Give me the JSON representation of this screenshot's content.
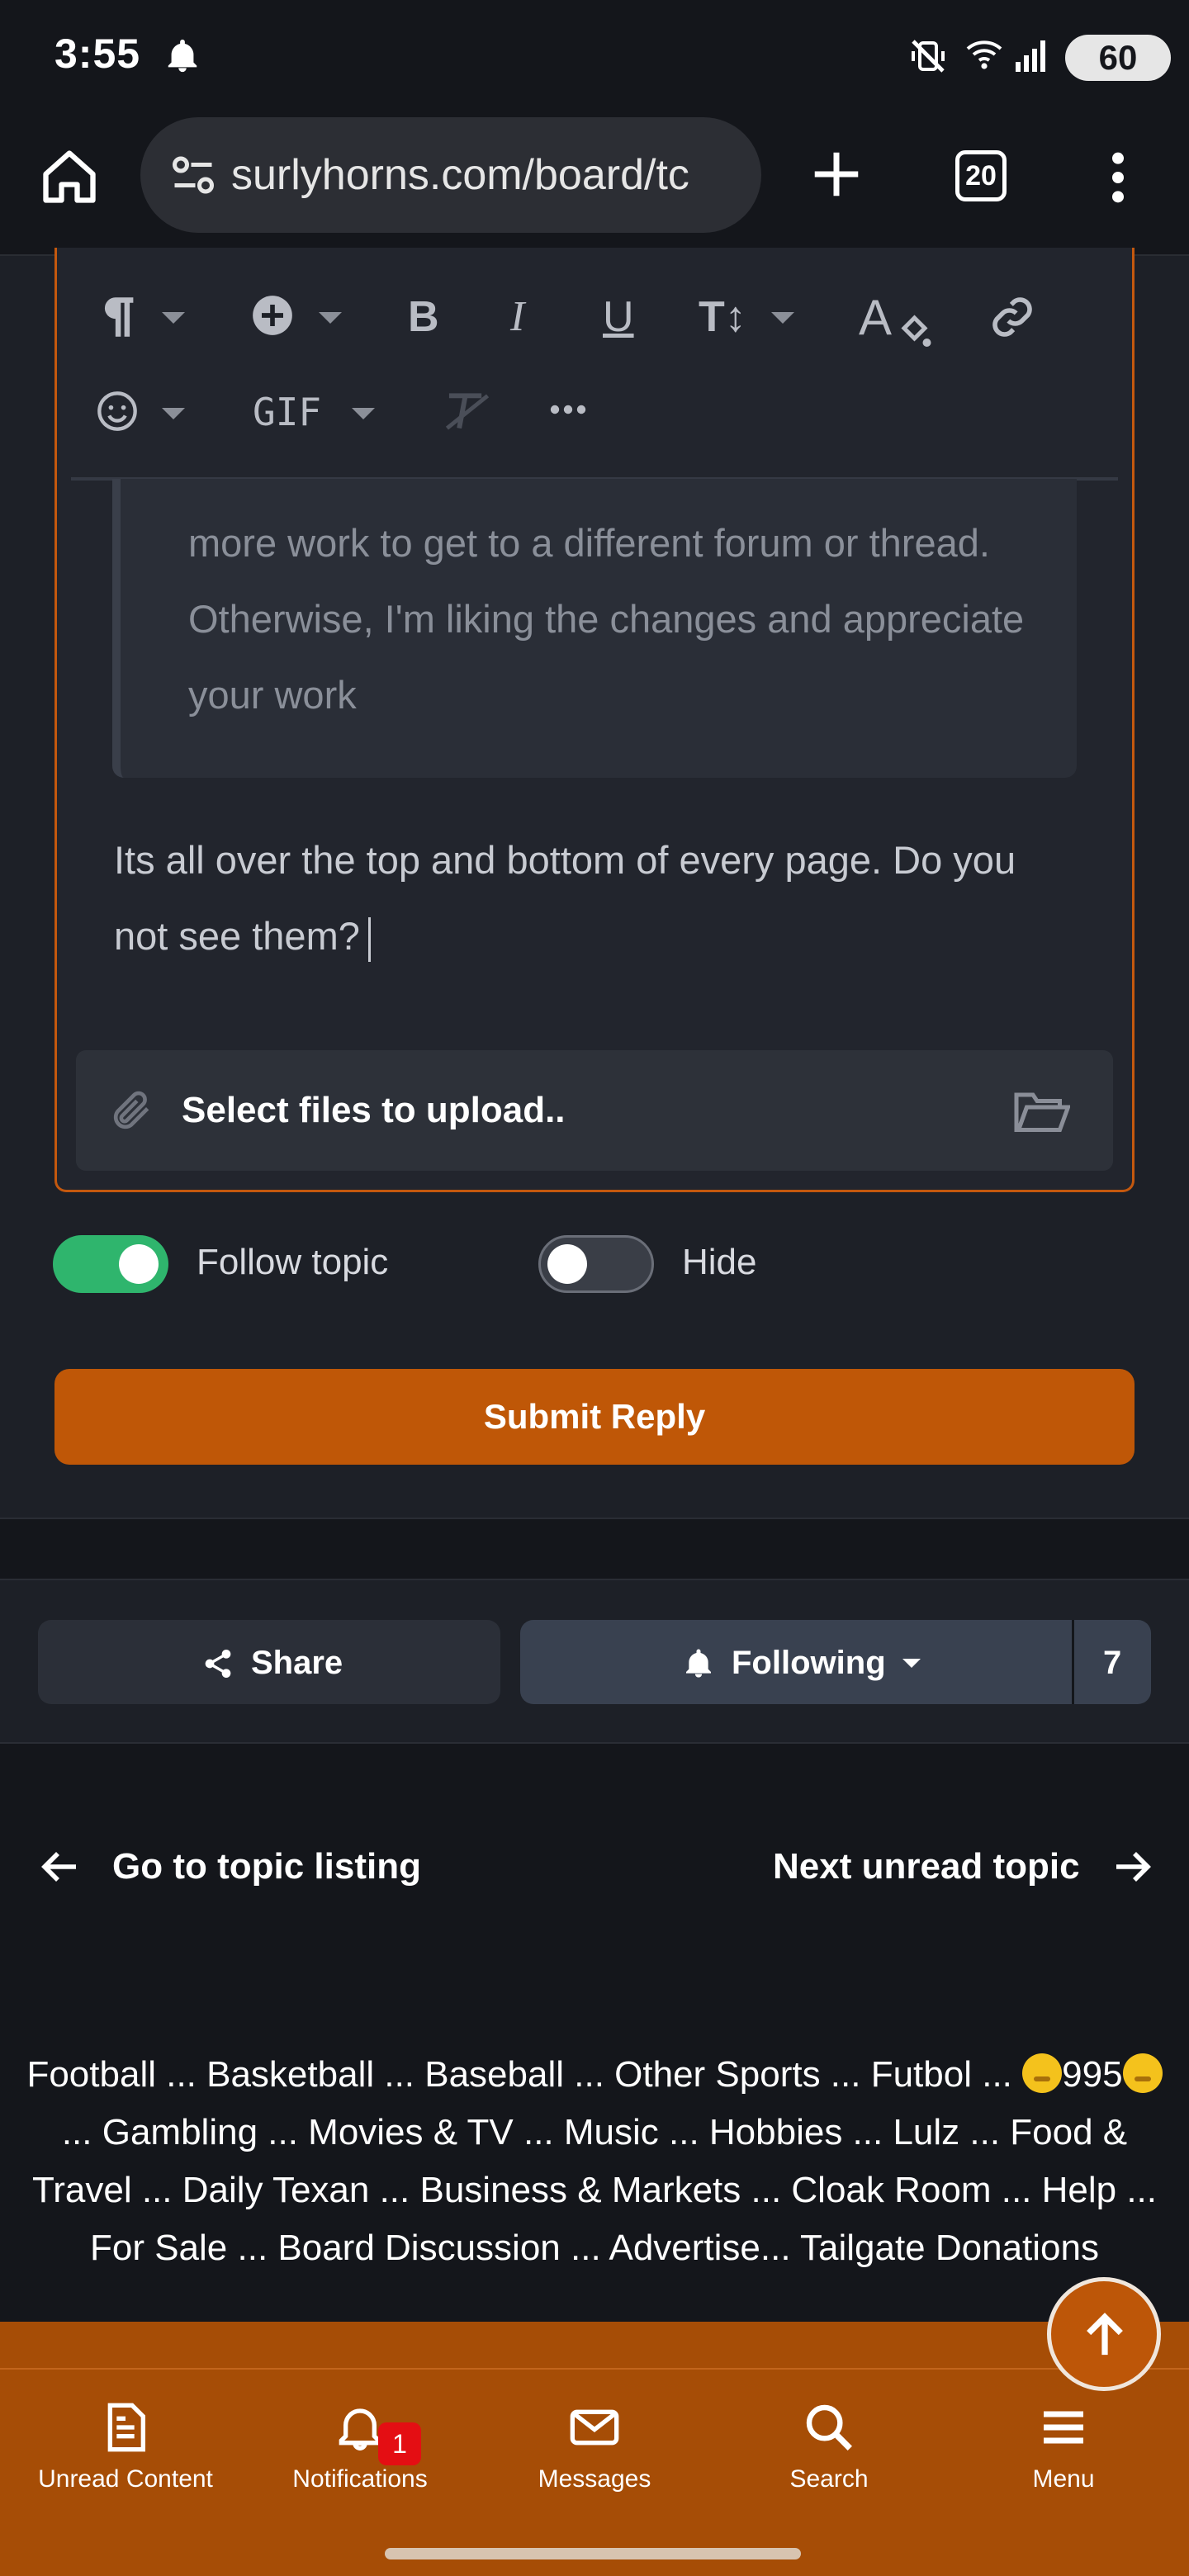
{
  "status_bar": {
    "time": "3:55",
    "battery": "60"
  },
  "browser": {
    "url": "surlyhorns.com/board/tc",
    "tab_count": "20"
  },
  "editor": {
    "toolbar_gif_label": "GIF",
    "quoted_text": "more work to get to a different forum or thread. Otherwise, I'm liking the changes and appreciate your work",
    "reply_text": "Its all over the top and bottom of every page. Do you not see them?",
    "upload_label": "Select files to upload.."
  },
  "options": {
    "follow_topic_label": "Follow topic",
    "follow_topic_on": true,
    "hide_label": "Hide",
    "hide_on": false
  },
  "submit_label": "Submit Reply",
  "share_bar": {
    "share_label": "Share",
    "following_label": "Following",
    "followers_count": "7"
  },
  "topic_nav": {
    "prev_label": "Go to topic listing",
    "next_label": "Next unread topic"
  },
  "footer_links": {
    "line1_a": "Football ... Basketball ... Baseball ... Other Sports ... Futbol ... ",
    "line1_b": "995",
    "line2": "... Gambling ... Movies & TV ... Music ... Hobbies ... Lulz ... Food &",
    "line3": "Travel ... Daily Texan ... Business & Markets ... Cloak Room ... Help ...",
    "line4": "For Sale ... Board Discussion ... Advertise... Tailgate Donations"
  },
  "bottom_nav": {
    "items": [
      {
        "label": "Unread Content",
        "icon": "document-icon"
      },
      {
        "label": "Notifications",
        "icon": "bell-icon"
      },
      {
        "label": "Messages",
        "icon": "envelope-icon"
      },
      {
        "label": "Search",
        "icon": "search-icon"
      },
      {
        "label": "Menu",
        "icon": "menu-icon"
      }
    ],
    "notification_badge": "1"
  },
  "colors": {
    "accent_orange": "#bf5707",
    "toggle_on": "#2fb56d",
    "bottom_nav_bg": "#a64d06"
  }
}
